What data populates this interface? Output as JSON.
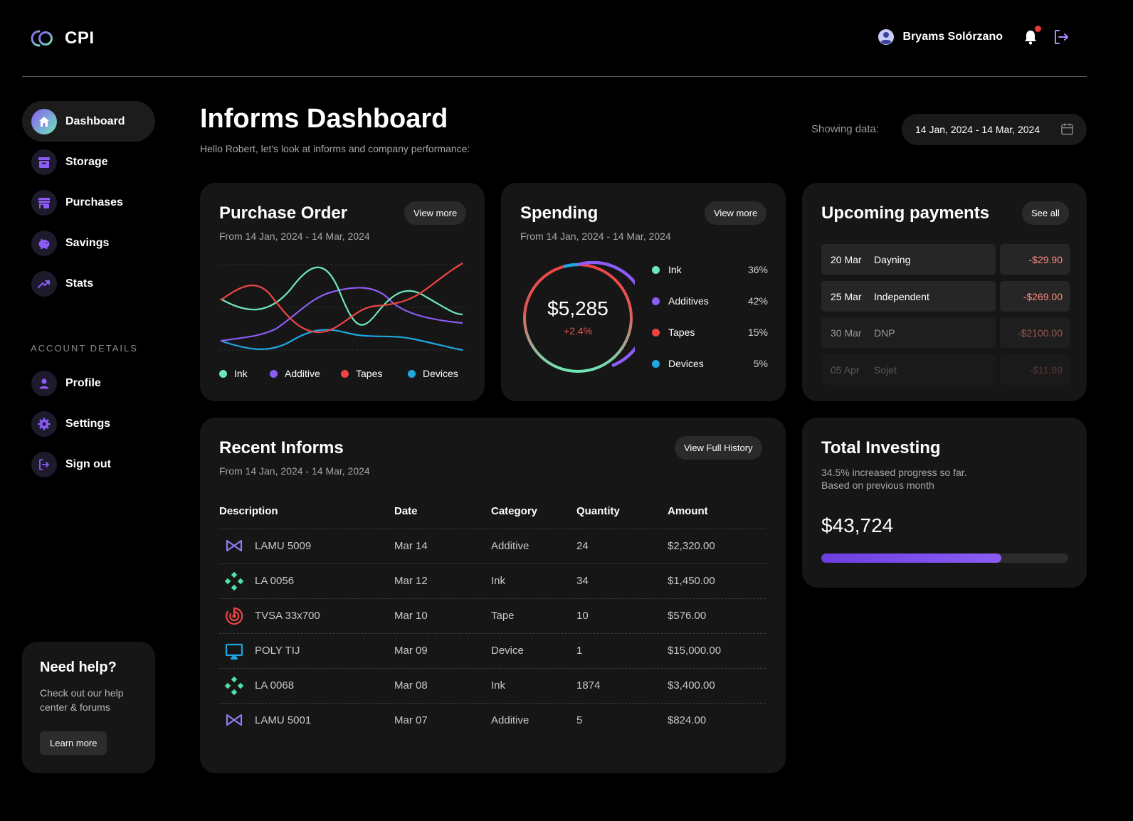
{
  "app": {
    "logo": "CPI"
  },
  "header": {
    "user_name": "Bryams Solórzano"
  },
  "sidebar": {
    "items": [
      {
        "label": "Dashboard"
      },
      {
        "label": "Storage"
      },
      {
        "label": "Purchases"
      },
      {
        "label": "Savings"
      },
      {
        "label": "Stats"
      }
    ],
    "section_label": "ACCOUNT DETAILS",
    "account_items": [
      {
        "label": "Profile"
      },
      {
        "label": "Settings"
      },
      {
        "label": "Sign out"
      }
    ],
    "help": {
      "title": "Need help?",
      "text": "Check out our help center & forums",
      "button": "Learn more"
    }
  },
  "page": {
    "title": "Informs Dashboard",
    "subtitle": "Hello Robert, let's look at informs and company performance:",
    "showing_label": "Showing data:",
    "date_range": "14 Jan, 2024 - 14 Mar, 2024"
  },
  "purchase_order": {
    "title": "Purchase Order",
    "subtitle": "From 14 Jan, 2024 - 14 Mar, 2024",
    "button": "View more",
    "legend": [
      "Ink",
      "Additive",
      "Tapes",
      "Devices"
    ]
  },
  "spending": {
    "title": "Spending",
    "subtitle": "From 14 Jan, 2024 - 14 Mar, 2024",
    "button": "View more",
    "total": "$5,285",
    "change": "+2.4%",
    "items": [
      {
        "name": "Ink",
        "pct": "36%"
      },
      {
        "name": "Additives",
        "pct": "42%"
      },
      {
        "name": "Tapes",
        "pct": "15%"
      },
      {
        "name": "Devices",
        "pct": "5%"
      }
    ]
  },
  "upcoming": {
    "title": "Upcoming payments",
    "button": "See all",
    "rows": [
      {
        "date": "20 Mar",
        "name": "Dayning",
        "amount": "-$29.90"
      },
      {
        "date": "25 Mar",
        "name": "Independent",
        "amount": "-$269.00"
      },
      {
        "date": "30 Mar",
        "name": "DNP",
        "amount": "-$2100.00"
      },
      {
        "date": "05 Apr",
        "name": "Sojet",
        "amount": "-$11.99"
      }
    ]
  },
  "recent": {
    "title": "Recent Informs",
    "subtitle": "From 14 Jan, 2024 - 14 Mar, 2024",
    "button": "View Full History",
    "columns": [
      "Description",
      "Date",
      "Category",
      "Quantity",
      "Amount"
    ],
    "rows": [
      {
        "desc": "LAMU 5009",
        "date": "Mar 14",
        "cat": "Additive",
        "qty": "24",
        "amount": "$2,320.00",
        "icon": "infinity-icon"
      },
      {
        "desc": "LA 0056",
        "date": "Mar 12",
        "cat": "Ink",
        "qty": "34",
        "amount": "$1,450.00",
        "icon": "diamond-grid-icon"
      },
      {
        "desc": "TVSA 33x700",
        "date": "Mar 10",
        "cat": "Tape",
        "qty": "10",
        "amount": "$576.00",
        "icon": "target-icon"
      },
      {
        "desc": "POLY TIJ",
        "date": "Mar 09",
        "cat": "Device",
        "qty": "1",
        "amount": "$15,000.00",
        "icon": "monitor-icon"
      },
      {
        "desc": "LA 0068",
        "date": "Mar 08",
        "cat": "Ink",
        "qty": "1874",
        "amount": "$3,400.00",
        "icon": "diamond-grid-icon"
      },
      {
        "desc": "LAMU 5001",
        "date": "Mar 07",
        "cat": "Additive",
        "qty": "5",
        "amount": "$824.00",
        "icon": "infinity-icon"
      }
    ]
  },
  "investing": {
    "title": "Total Investing",
    "line1": "34.5% increased progress so far.",
    "line2": "Based on previous month",
    "value": "$43,724",
    "progress": 0.73
  },
  "colors": {
    "ink": "#6ee7b7",
    "additive": "#8b5cf6",
    "tapes": "#ef4444",
    "devices": "#1ea7e1"
  }
}
